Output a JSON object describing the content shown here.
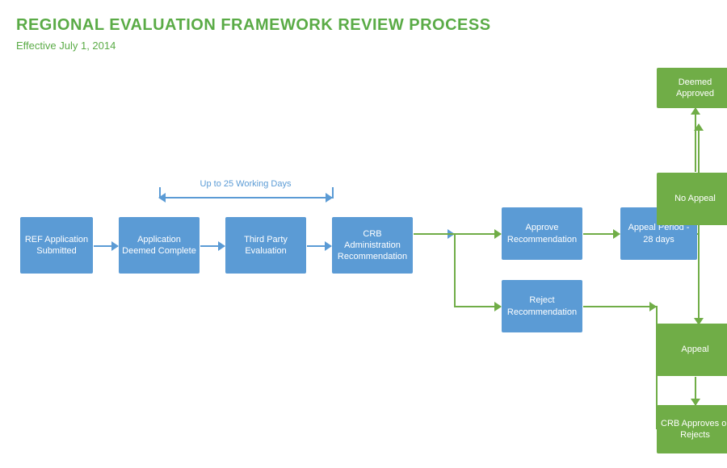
{
  "title": "REGIONAL EVALUATION FRAMEWORK REVIEW PROCESS",
  "subtitle": "Effective July 1, 2014",
  "boxes": {
    "ref_application": "REF Application Submitted",
    "application_deemed": "Application Deemed Complete",
    "third_party": "Third Party Evaluation",
    "crb_admin": "CRB Administration Recommendation",
    "approve_rec": "Approve Recommendation",
    "reject_rec": "Reject Recommendation",
    "appeal_period": "Appeal Period - 28 days",
    "no_appeal": "No Appeal",
    "appeal": "Appeal",
    "deemed_approved": "Deemed Approved",
    "crb_approves": "CRB Approves or Rejects"
  },
  "labels": {
    "working_days": "Up to 25 Working Days"
  }
}
